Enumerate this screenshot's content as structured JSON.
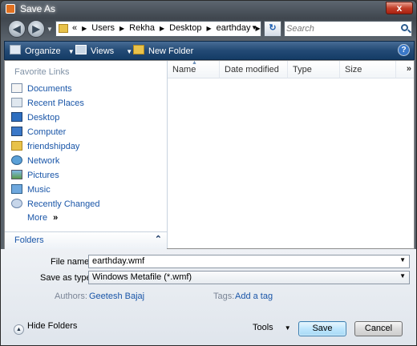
{
  "window": {
    "title": "Save As",
    "close_label": "x"
  },
  "address": {
    "breadcrumbs": [
      "Users",
      "Rekha",
      "Desktop",
      "earthday"
    ],
    "overflow": "«",
    "search_placeholder": "Search"
  },
  "toolbar": {
    "organize": "Organize",
    "views": "Views",
    "new_folder": "New Folder",
    "help": "?"
  },
  "sidebar": {
    "heading": "Favorite Links",
    "items": [
      {
        "label": "Documents",
        "icon": "documents-icon"
      },
      {
        "label": "Recent Places",
        "icon": "recent-places-icon"
      },
      {
        "label": "Desktop",
        "icon": "desktop-icon"
      },
      {
        "label": "Computer",
        "icon": "computer-icon"
      },
      {
        "label": "friendshipday",
        "icon": "folder-icon"
      },
      {
        "label": "Network",
        "icon": "network-icon"
      },
      {
        "label": "Pictures",
        "icon": "pictures-icon"
      },
      {
        "label": "Music",
        "icon": "music-icon"
      },
      {
        "label": "Recently Changed",
        "icon": "recently-changed-icon"
      }
    ],
    "more": "More",
    "more_chevron": "»",
    "folders": "Folders"
  },
  "columns": [
    "Name",
    "Date modified",
    "Type",
    "Size"
  ],
  "columns_more": "»",
  "form": {
    "file_name_label": "File name:",
    "file_name_value": "earthday.wmf",
    "save_type_label": "Save as type:",
    "save_type_value": "Windows Metafile (*.wmf)",
    "authors_label": "Authors:",
    "authors_value": "Geetesh Bajaj",
    "tags_label": "Tags:",
    "tags_value": "Add a tag"
  },
  "footer": {
    "hide_folders": "Hide Folders",
    "tools": "Tools",
    "save": "Save",
    "cancel": "Cancel"
  },
  "colors": {
    "accent": "#1a56a8",
    "toolbar": "#234a75",
    "close": "#c2402a"
  }
}
